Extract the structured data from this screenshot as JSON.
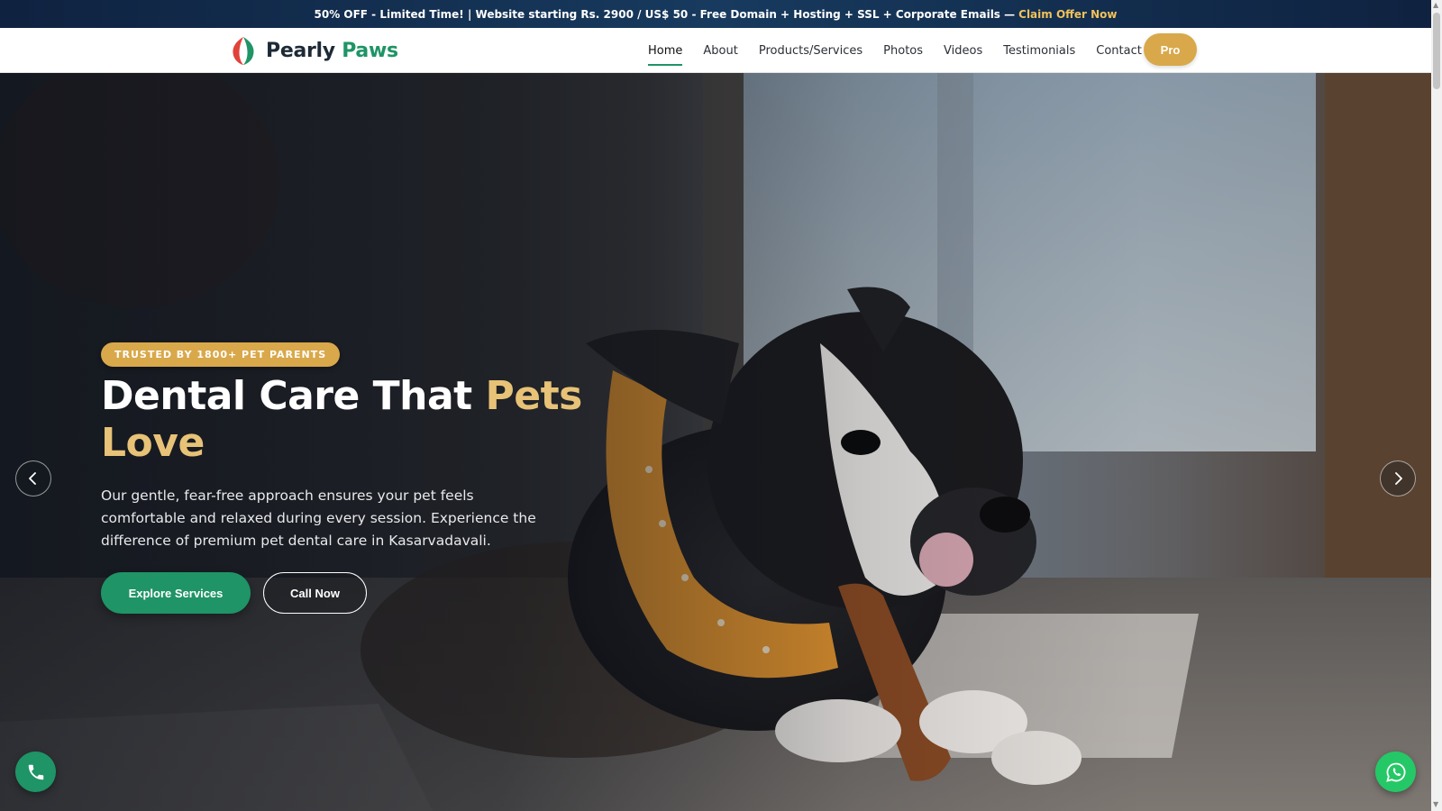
{
  "promo": {
    "text": "50% OFF - Limited Time! | Website starting Rs. 2900 / US$ 50 - Free Domain + Hosting + SSL + Corporate Emails —",
    "link": "Claim Offer Now"
  },
  "brand": {
    "name_primary": "Pearly",
    "name_accent": "Paws",
    "logo_icon": "leaf-drop-logo-icon",
    "colors": {
      "green": "#1f9466",
      "red": "#e0433a",
      "gold": "#d9a84a"
    }
  },
  "nav": {
    "items": [
      {
        "label": "Home",
        "active": true
      },
      {
        "label": "About"
      },
      {
        "label": "Products/Services"
      },
      {
        "label": "Photos"
      },
      {
        "label": "Videos"
      },
      {
        "label": "Testimonials"
      },
      {
        "label": "Contact"
      }
    ],
    "pro_label": "Pro"
  },
  "hero": {
    "badge": "TRUSTED BY 1800+ PET PARENTS",
    "title_white": "Dental Care That",
    "title_gold": "Pets Love",
    "description": "Our gentle, fear-free approach ensures your pet feels comfortable and relaxed during every session. Experience the difference of premium pet dental care in Kasarvadavali.",
    "primary_button": "Explore Services",
    "secondary_button": "Call Now",
    "image": "boston-terrier-puppy-chewing-bone",
    "accent_gold": "#e7c277"
  },
  "carousel": {
    "prev_icon": "chevron-left-icon",
    "next_icon": "chevron-right-icon"
  },
  "floating": {
    "phone_icon": "phone-icon",
    "whatsapp_icon": "whatsapp-icon"
  }
}
